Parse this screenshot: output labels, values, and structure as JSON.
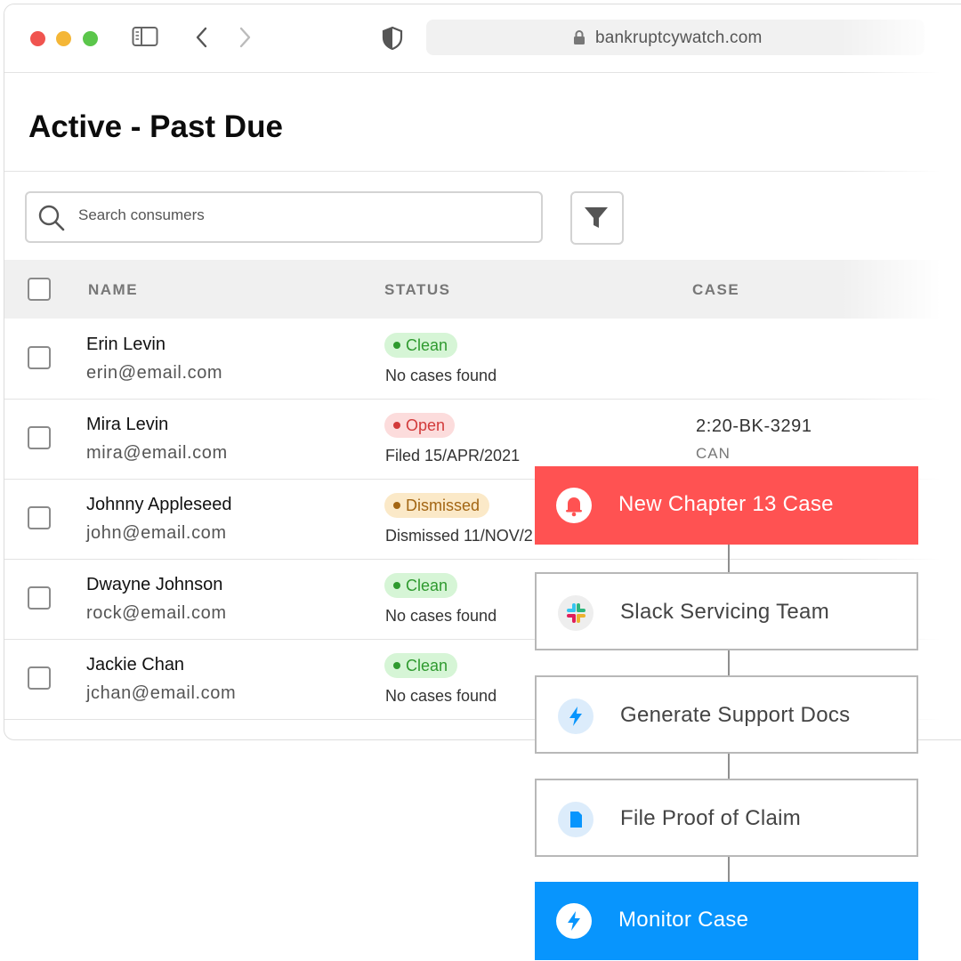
{
  "browser": {
    "url": "bankruptcywatch.com"
  },
  "page": {
    "title": "Active - Past Due"
  },
  "search": {
    "placeholder": "Search consumers"
  },
  "table": {
    "headers": [
      "NAME",
      "STATUS",
      "CASE"
    ],
    "rows": [
      {
        "name": "Erin Levin",
        "email": "erin@email.com",
        "status": "Clean",
        "status_detail": "No cases found",
        "case_number": "",
        "case_court": ""
      },
      {
        "name": "Mira Levin",
        "email": "mira@email.com",
        "status": "Open",
        "status_detail": "Filed 15/APR/2021",
        "case_number": "2:20-BK-3291",
        "case_court": "CAN"
      },
      {
        "name": "Johnny Appleseed",
        "email": "john@email.com",
        "status": "Dismissed",
        "status_detail": "Dismissed 11/NOV/2",
        "case_number": "",
        "case_court": ""
      },
      {
        "name": "Dwayne Johnson",
        "email": "rock@email.com",
        "status": "Clean",
        "status_detail": "No cases found",
        "case_number": "",
        "case_court": ""
      },
      {
        "name": "Jackie Chan",
        "email": "jchan@email.com",
        "status": "Clean",
        "status_detail": "No cases found",
        "case_number": "",
        "case_court": ""
      }
    ]
  },
  "workflow": {
    "steps": [
      {
        "label": "New Chapter 13 Case",
        "icon": "bell-icon",
        "color": "#ff5252"
      },
      {
        "label": "Slack Servicing Team",
        "icon": "slack-icon"
      },
      {
        "label": "Generate Support Docs",
        "icon": "lightning-icon"
      },
      {
        "label": "File Proof of Claim",
        "icon": "document-icon"
      },
      {
        "label": "Monitor Case",
        "icon": "lightning-icon",
        "color": "#0895fd"
      }
    ]
  }
}
